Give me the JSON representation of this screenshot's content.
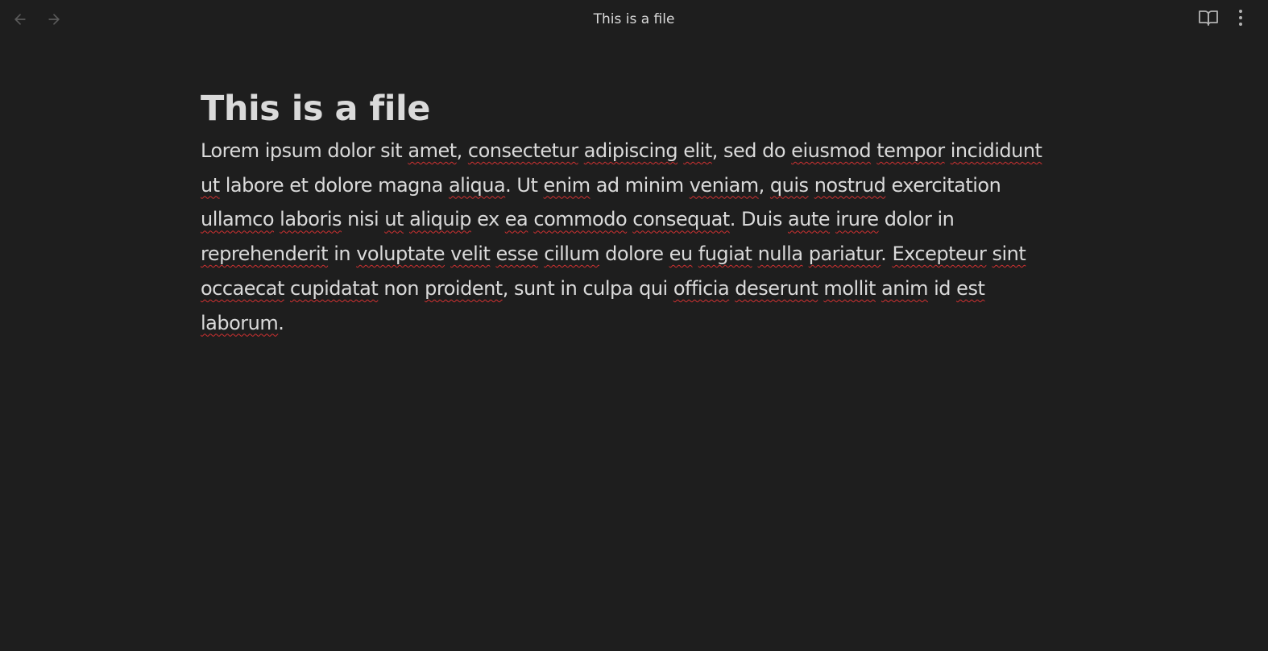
{
  "header": {
    "title": "This is a file",
    "back_icon": "arrow-left-icon",
    "forward_icon": "arrow-right-icon",
    "reading_view_icon": "open-book-icon",
    "more_options_icon": "more-vertical-icon"
  },
  "document": {
    "heading": "This is a file",
    "paragraph": [
      {
        "t": "Lorem ipsum dolor sit ",
        "s": false
      },
      {
        "t": "amet",
        "s": true
      },
      {
        "t": ", ",
        "s": false
      },
      {
        "t": "consectetur",
        "s": true
      },
      {
        "t": " ",
        "s": false
      },
      {
        "t": "adipiscing",
        "s": true
      },
      {
        "t": " ",
        "s": false
      },
      {
        "t": "elit",
        "s": true
      },
      {
        "t": ", sed do ",
        "s": false
      },
      {
        "t": "eiusmod",
        "s": true
      },
      {
        "t": " ",
        "s": false
      },
      {
        "t": "tempor",
        "s": true
      },
      {
        "t": " ",
        "s": false
      },
      {
        "t": "incididunt",
        "s": true
      },
      {
        "t": " ",
        "s": false
      },
      {
        "t": "ut",
        "s": true
      },
      {
        "t": " labore et dolore magna ",
        "s": false
      },
      {
        "t": "aliqua",
        "s": true
      },
      {
        "t": ". Ut ",
        "s": false
      },
      {
        "t": "enim",
        "s": true
      },
      {
        "t": " ad minim ",
        "s": false
      },
      {
        "t": "veniam",
        "s": true
      },
      {
        "t": ", ",
        "s": false
      },
      {
        "t": "quis",
        "s": true
      },
      {
        "t": " ",
        "s": false
      },
      {
        "t": "nostrud",
        "s": true
      },
      {
        "t": " exercitation ",
        "s": false
      },
      {
        "t": "ullamco",
        "s": true
      },
      {
        "t": " ",
        "s": false
      },
      {
        "t": "laboris",
        "s": true
      },
      {
        "t": " nisi ",
        "s": false
      },
      {
        "t": "ut",
        "s": true
      },
      {
        "t": " ",
        "s": false
      },
      {
        "t": "aliquip",
        "s": true
      },
      {
        "t": " ex ",
        "s": false
      },
      {
        "t": "ea",
        "s": true
      },
      {
        "t": " ",
        "s": false
      },
      {
        "t": "commodo",
        "s": true
      },
      {
        "t": " ",
        "s": false
      },
      {
        "t": "consequat",
        "s": true
      },
      {
        "t": ". Duis ",
        "s": false
      },
      {
        "t": "aute",
        "s": true
      },
      {
        "t": " ",
        "s": false
      },
      {
        "t": "irure",
        "s": true
      },
      {
        "t": " dolor in ",
        "s": false
      },
      {
        "t": "reprehenderit",
        "s": true
      },
      {
        "t": " in ",
        "s": false
      },
      {
        "t": "voluptate",
        "s": true
      },
      {
        "t": " ",
        "s": false
      },
      {
        "t": "velit",
        "s": true
      },
      {
        "t": " ",
        "s": false
      },
      {
        "t": "esse",
        "s": true
      },
      {
        "t": " ",
        "s": false
      },
      {
        "t": "cillum",
        "s": true
      },
      {
        "t": " dolore ",
        "s": false
      },
      {
        "t": "eu",
        "s": true
      },
      {
        "t": " ",
        "s": false
      },
      {
        "t": "fugiat",
        "s": true
      },
      {
        "t": " ",
        "s": false
      },
      {
        "t": "nulla",
        "s": true
      },
      {
        "t": " ",
        "s": false
      },
      {
        "t": "pariatur",
        "s": true
      },
      {
        "t": ". ",
        "s": false
      },
      {
        "t": "Excepteur",
        "s": true
      },
      {
        "t": " ",
        "s": false
      },
      {
        "t": "sint",
        "s": true
      },
      {
        "t": " ",
        "s": false
      },
      {
        "t": "occaecat",
        "s": true
      },
      {
        "t": " ",
        "s": false
      },
      {
        "t": "cupidatat",
        "s": true
      },
      {
        "t": " non ",
        "s": false
      },
      {
        "t": "proident",
        "s": true
      },
      {
        "t": ", sunt in culpa qui ",
        "s": false
      },
      {
        "t": "officia",
        "s": true
      },
      {
        "t": " ",
        "s": false
      },
      {
        "t": "deserunt",
        "s": true
      },
      {
        "t": " ",
        "s": false
      },
      {
        "t": "mollit",
        "s": true
      },
      {
        "t": " ",
        "s": false
      },
      {
        "t": "anim",
        "s": true
      },
      {
        "t": " id ",
        "s": false
      },
      {
        "t": "est",
        "s": true
      },
      {
        "t": " ",
        "s": false
      },
      {
        "t": "laborum",
        "s": true
      },
      {
        "t": ".",
        "s": false
      }
    ]
  },
  "colors": {
    "background": "#1e1e1e",
    "text": "#dadada",
    "icon_muted": "#5a5a5a",
    "icon": "#b3b3b3",
    "spellcheck_underline": "#d03131"
  }
}
